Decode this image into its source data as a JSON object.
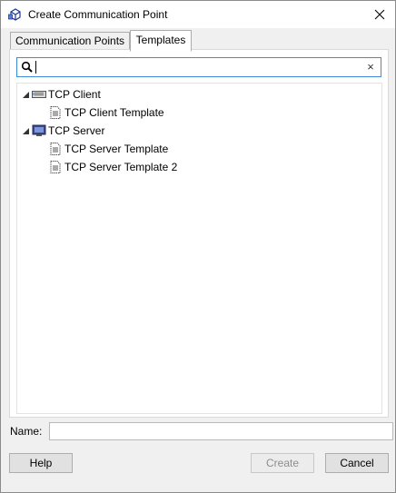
{
  "window": {
    "title": "Create Communication Point",
    "app_icon": "network-cube-icon",
    "close_icon": "close-icon"
  },
  "tabs": [
    {
      "label": "Communication Points",
      "active": false
    },
    {
      "label": "Templates",
      "active": true
    }
  ],
  "search": {
    "value": "",
    "placeholder": "",
    "search_icon": "search-icon",
    "clear_label": "×"
  },
  "tree": [
    {
      "label": "TCP Client",
      "icon": "tcp-client-icon",
      "expanded": true,
      "children": [
        {
          "label": "TCP Client Template",
          "icon": "template-doc-icon"
        }
      ]
    },
    {
      "label": "TCP Server",
      "icon": "tcp-server-icon",
      "expanded": true,
      "children": [
        {
          "label": "TCP Server Template",
          "icon": "template-doc-icon"
        },
        {
          "label": "TCP Server Template 2",
          "icon": "template-doc-icon"
        }
      ]
    }
  ],
  "name": {
    "label": "Name:",
    "value": ""
  },
  "buttons": {
    "help": "Help",
    "create": "Create",
    "cancel": "Cancel",
    "create_enabled": false
  },
  "colors": {
    "accent": "#3c8fd6",
    "window_bg": "#f0f0f0",
    "button_bg": "#e1e1e1"
  }
}
